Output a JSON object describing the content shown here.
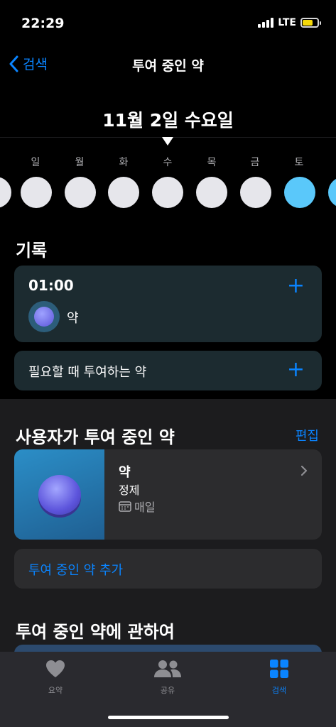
{
  "status": {
    "time": "22:29",
    "network": "LTE"
  },
  "nav": {
    "back_label": "검색",
    "title": "투여 중인 약"
  },
  "date": {
    "title": "11월 2일 수요일"
  },
  "weekdays": [
    "일",
    "월",
    "화",
    "수",
    "목",
    "금",
    "토"
  ],
  "log": {
    "title": "기록",
    "time": "01:00",
    "med_name": "약",
    "as_needed": "필요할 때 투여하는 약"
  },
  "meds": {
    "title": "사용자가 투여 중인 약",
    "edit": "편집",
    "name": "약",
    "form": "정제",
    "schedule": "매일",
    "add": "투여 중인 약 추가"
  },
  "about": {
    "title": "투여 중인 약에 관하여"
  },
  "tabs": [
    {
      "label": "요약"
    },
    {
      "label": "공유"
    },
    {
      "label": "검색"
    }
  ],
  "colors": {
    "accent": "#0a84ff",
    "today_circle": "#5ac8fa",
    "card": "#1c2b30"
  }
}
